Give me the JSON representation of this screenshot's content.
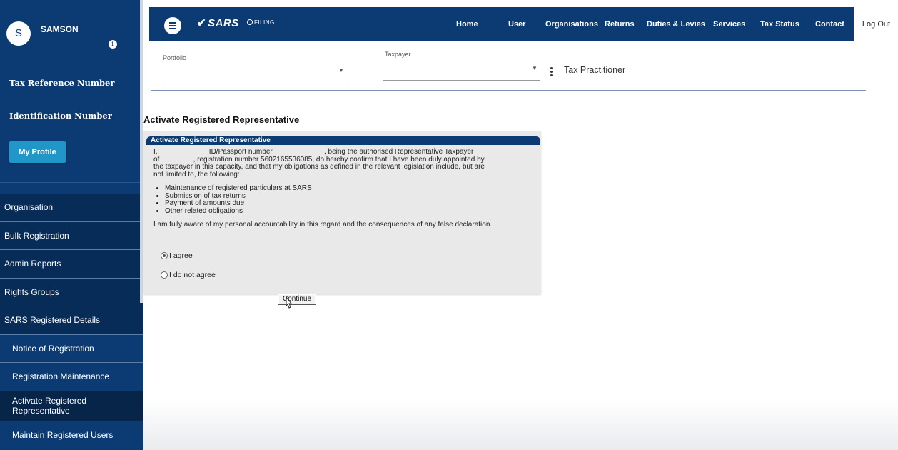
{
  "sidebar": {
    "avatar_letter": "S",
    "user_name": "SAMSON",
    "info_icon": "i",
    "tax_reference_label": "Tax Reference Number",
    "identification_label": "Identification Number",
    "profile_button": "My Profile",
    "nav": [
      {
        "label": "Organisation",
        "type": "section"
      },
      {
        "label": "Bulk Registration",
        "type": "section"
      },
      {
        "label": "Admin Reports",
        "type": "section"
      },
      {
        "label": "Rights Groups",
        "type": "section"
      },
      {
        "label": "SARS Registered Details",
        "type": "section"
      },
      {
        "label": "Notice of Registration",
        "type": "sub"
      },
      {
        "label": "Registration Maintenance",
        "type": "sub"
      },
      {
        "label": "Activate Registered Representative",
        "type": "sub-active"
      },
      {
        "label": "Maintain Registered Users",
        "type": "sub"
      }
    ]
  },
  "topbar": {
    "logo": "SARS",
    "logo_mark": "✔",
    "efiling": "FILING",
    "nav": [
      "Home",
      "User",
      "Organisations",
      "Returns",
      "Duties & Levies",
      "Services",
      "Tax Status",
      "Contact"
    ],
    "logout": "Log Out"
  },
  "filter": {
    "portfolio_label": "Portfolio",
    "portfolio_value": "",
    "taxpayer_label": "Taxpayer",
    "taxpayer_value": "",
    "practitioner": "Tax Practitioner"
  },
  "content": {
    "page_title": "Activate Registered Representative",
    "panel_title": "Activate Registered Representative",
    "declaration_line1": "I,                          ID/Passport number                          , being the authorised Representative Taxpayer",
    "declaration_line2": "of                 , registration number 5602165536085, do hereby confirm that I have been duly appointed by",
    "declaration_line3": "the taxpayer in this capacity, and that my obligations as defined in the relevant legislation include, but are",
    "declaration_line4": "not limited to, the following:",
    "obligations": [
      "Maintenance of registered particulars at SARS",
      "Submission of tax returns",
      "Payment of amounts due",
      "Other related obligations"
    ],
    "accountability": "I am fully aware of my personal accountability in this regard and the consequences of any false declaration.",
    "agree_label": "I agree",
    "disagree_label": "I do not agree",
    "selected": "agree",
    "continue_button": "Continue"
  }
}
